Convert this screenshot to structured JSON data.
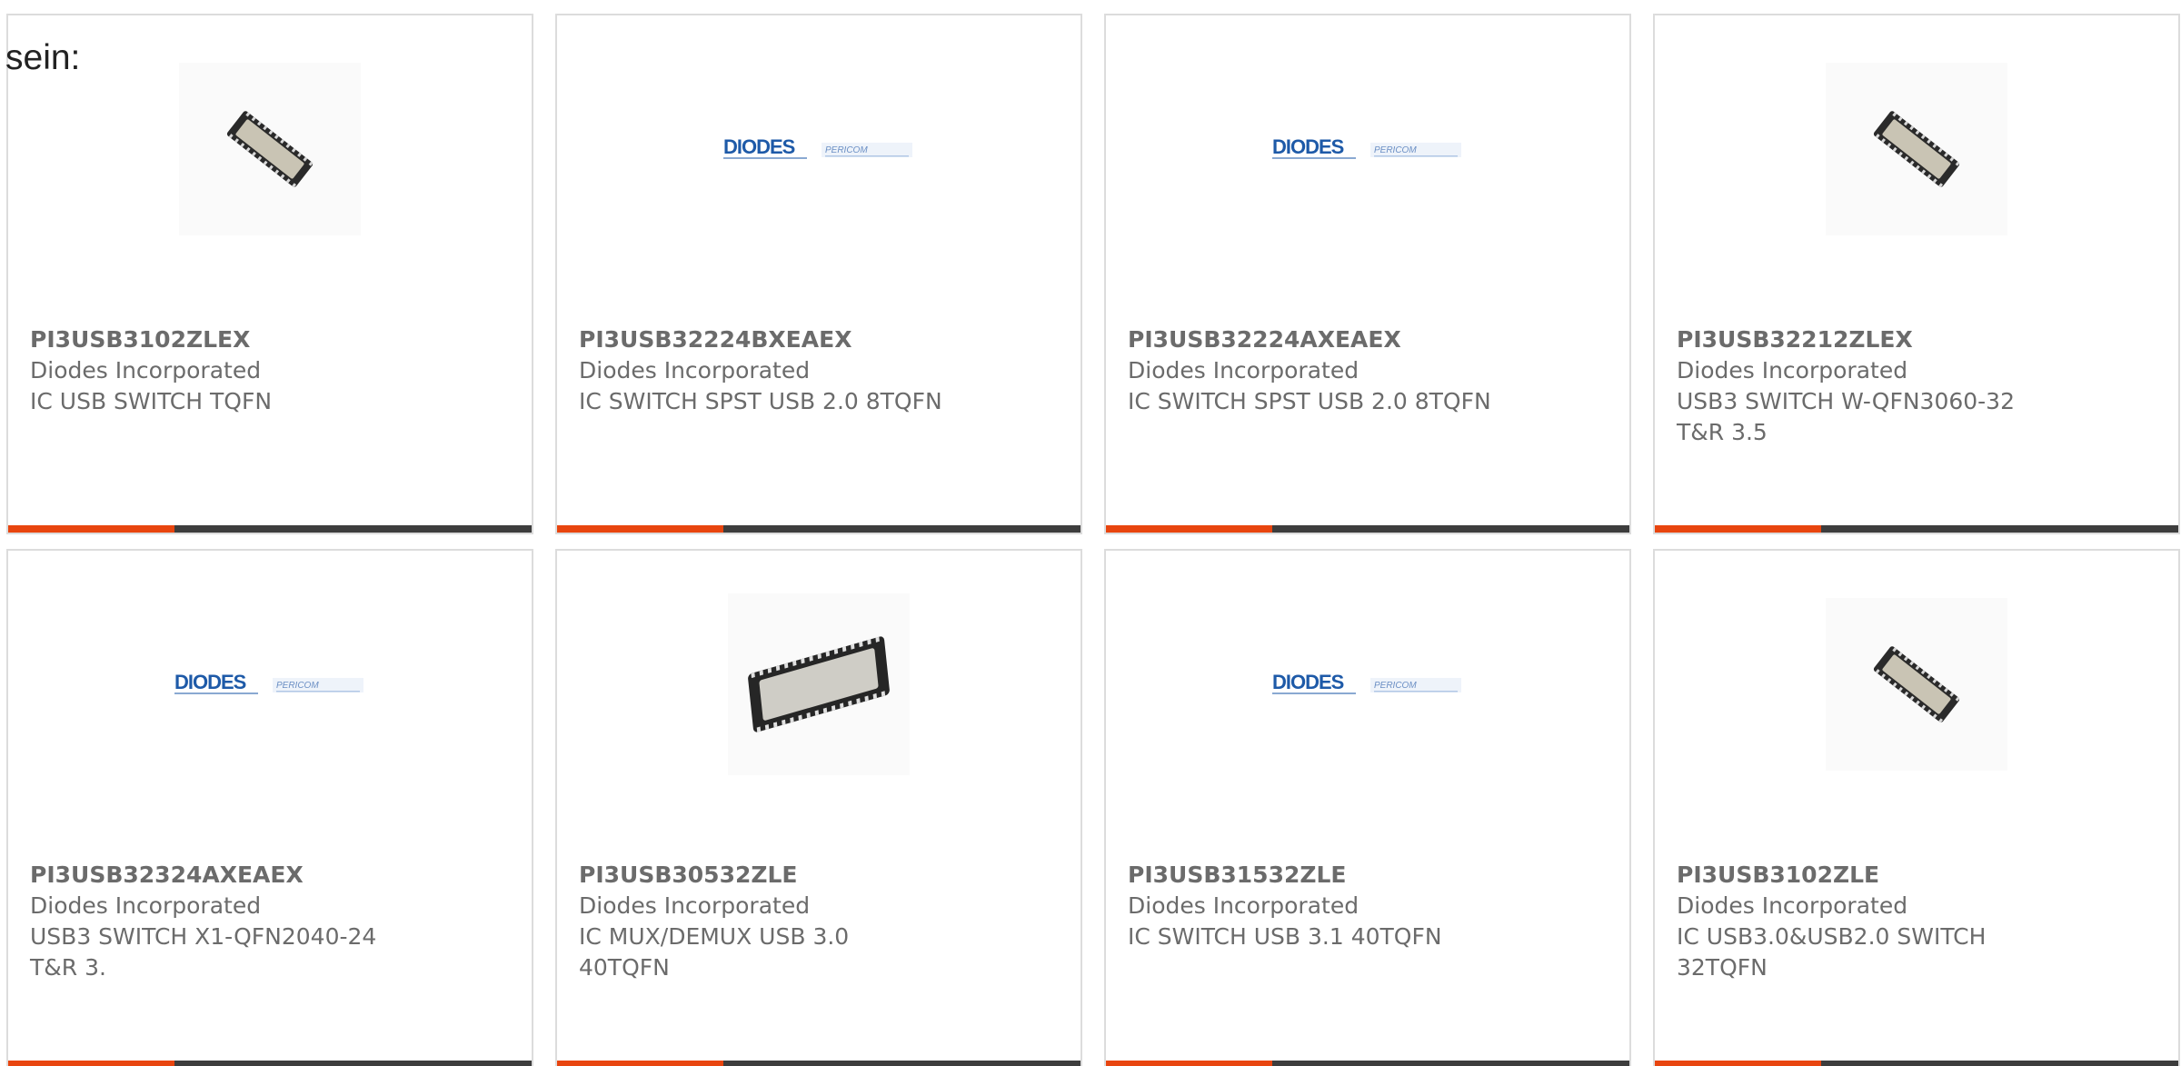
{
  "intro_text": "sein:",
  "colors": {
    "accent": "#e8450f",
    "bar": "#3d3d3d",
    "text": "#6b6b6b",
    "diodes_blue": "#1e5aa8"
  },
  "logo_text": {
    "brand": "DIODES",
    "partner": "PERICOM"
  },
  "products": [
    {
      "part_number": "PI3USB3102ZLEX",
      "manufacturer": "Diodes Incorporated",
      "description": "IC USB SWITCH TQFN",
      "image": "small-qfn-chip-photo"
    },
    {
      "part_number": "PI3USB32224BXEAEX",
      "manufacturer": "Diodes Incorporated",
      "description": "IC SWITCH SPST USB 2.0 8TQFN",
      "image": "diodes-pericom-logo"
    },
    {
      "part_number": "PI3USB32224AXEAEX",
      "manufacturer": "Diodes Incorporated",
      "description": "IC SWITCH SPST USB 2.0 8TQFN",
      "image": "diodes-pericom-logo"
    },
    {
      "part_number": "PI3USB32212ZLEX",
      "manufacturer": "Diodes Incorporated",
      "description": "USB3 SWITCH W-QFN3060-32 T&R 3.5",
      "image": "small-qfn-chip-photo"
    },
    {
      "part_number": "PI3USB32324AXEAEX",
      "manufacturer": "Diodes Incorporated",
      "description": "USB3 SWITCH X1-QFN2040-24 T&R 3.",
      "image": "diodes-pericom-logo"
    },
    {
      "part_number": "PI3USB30532ZLE",
      "manufacturer": "Diodes Incorporated",
      "description": "IC MUX/DEMUX USB 3.0 40TQFN",
      "image": "large-qfn-chip-photo"
    },
    {
      "part_number": "PI3USB31532ZLE",
      "manufacturer": "Diodes Incorporated",
      "description": "IC SWITCH USB 3.1 40TQFN",
      "image": "diodes-pericom-logo"
    },
    {
      "part_number": "PI3USB3102ZLE",
      "manufacturer": "Diodes Incorporated",
      "description": "IC USB3.0&USB2.0 SWITCH 32TQFN",
      "image": "small-qfn-chip-photo"
    }
  ]
}
